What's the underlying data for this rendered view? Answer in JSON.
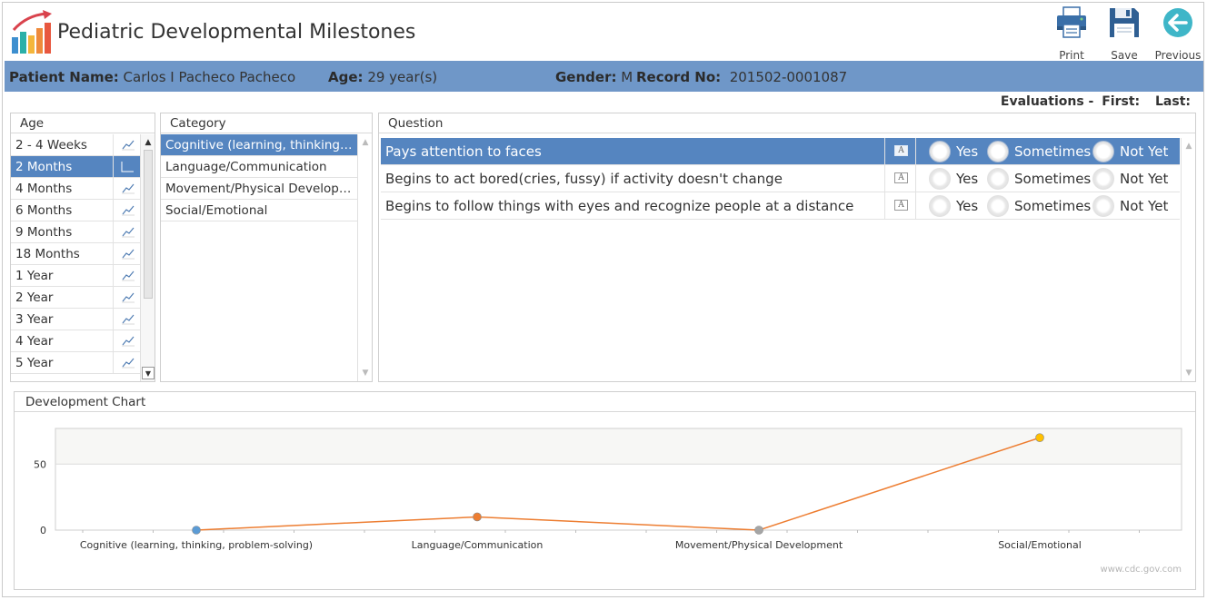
{
  "app": {
    "title": "Pediatric Developmental Milestones"
  },
  "toolbar": {
    "print_label": "Print",
    "save_label": "Save",
    "previous_label": "Previous"
  },
  "patient": {
    "name_label": "Patient Name:",
    "name_value": "Carlos I Pacheco Pacheco",
    "age_label": "Age:",
    "age_value": "29 year(s)",
    "gender_label": "Gender:",
    "gender_value": "M",
    "record_label": "Record No:",
    "record_value": "201502-0001087"
  },
  "evaluations": {
    "label": "Evaluations -",
    "first_label": "First:",
    "last_label": "Last:"
  },
  "age_panel": {
    "header": "Age",
    "items": [
      "2 - 4 Weeks",
      "2 Months",
      "4 Months",
      "6 Months",
      "9 Months",
      "18 Months",
      "1 Year",
      "2 Year",
      "3 Year",
      "4 Year",
      "5 Year"
    ],
    "selected_index": 1
  },
  "category_panel": {
    "header": "Category",
    "items": [
      "Cognitive (learning, thinking, problem-solving)",
      "Language/Communication",
      "Movement/Physical Development",
      "Social/Emotional"
    ],
    "selected_index": 0
  },
  "question_panel": {
    "header": "Question",
    "options": [
      "Yes",
      "Sometimes",
      "Not Yet"
    ],
    "questions": [
      "Pays attention to faces",
      "Begins to act bored(cries, fussy) if activity doesn't change",
      "Begins to follow things with eyes and recognize people at a distance"
    ],
    "selected_index": 0
  },
  "chart_panel": {
    "header": "Development Chart",
    "watermark": "www.cdc.gov.com"
  },
  "colors": {
    "accent": "#5585c0",
    "patient_bar": "#6f97c8",
    "line": "#ed7d31"
  },
  "chart_data": {
    "type": "line",
    "categories": [
      "Cognitive (learning, thinking, problem-solving)",
      "Language/Communication",
      "Movement/Physical Development",
      "Social/Emotional"
    ],
    "values": [
      0,
      10,
      0,
      70
    ],
    "point_colors": [
      "#5b9bd5",
      "#ed7d31",
      "#a5a5a5",
      "#ffc000"
    ],
    "yticks": [
      0,
      50
    ],
    "ylim": [
      0,
      77
    ],
    "grid": true
  }
}
